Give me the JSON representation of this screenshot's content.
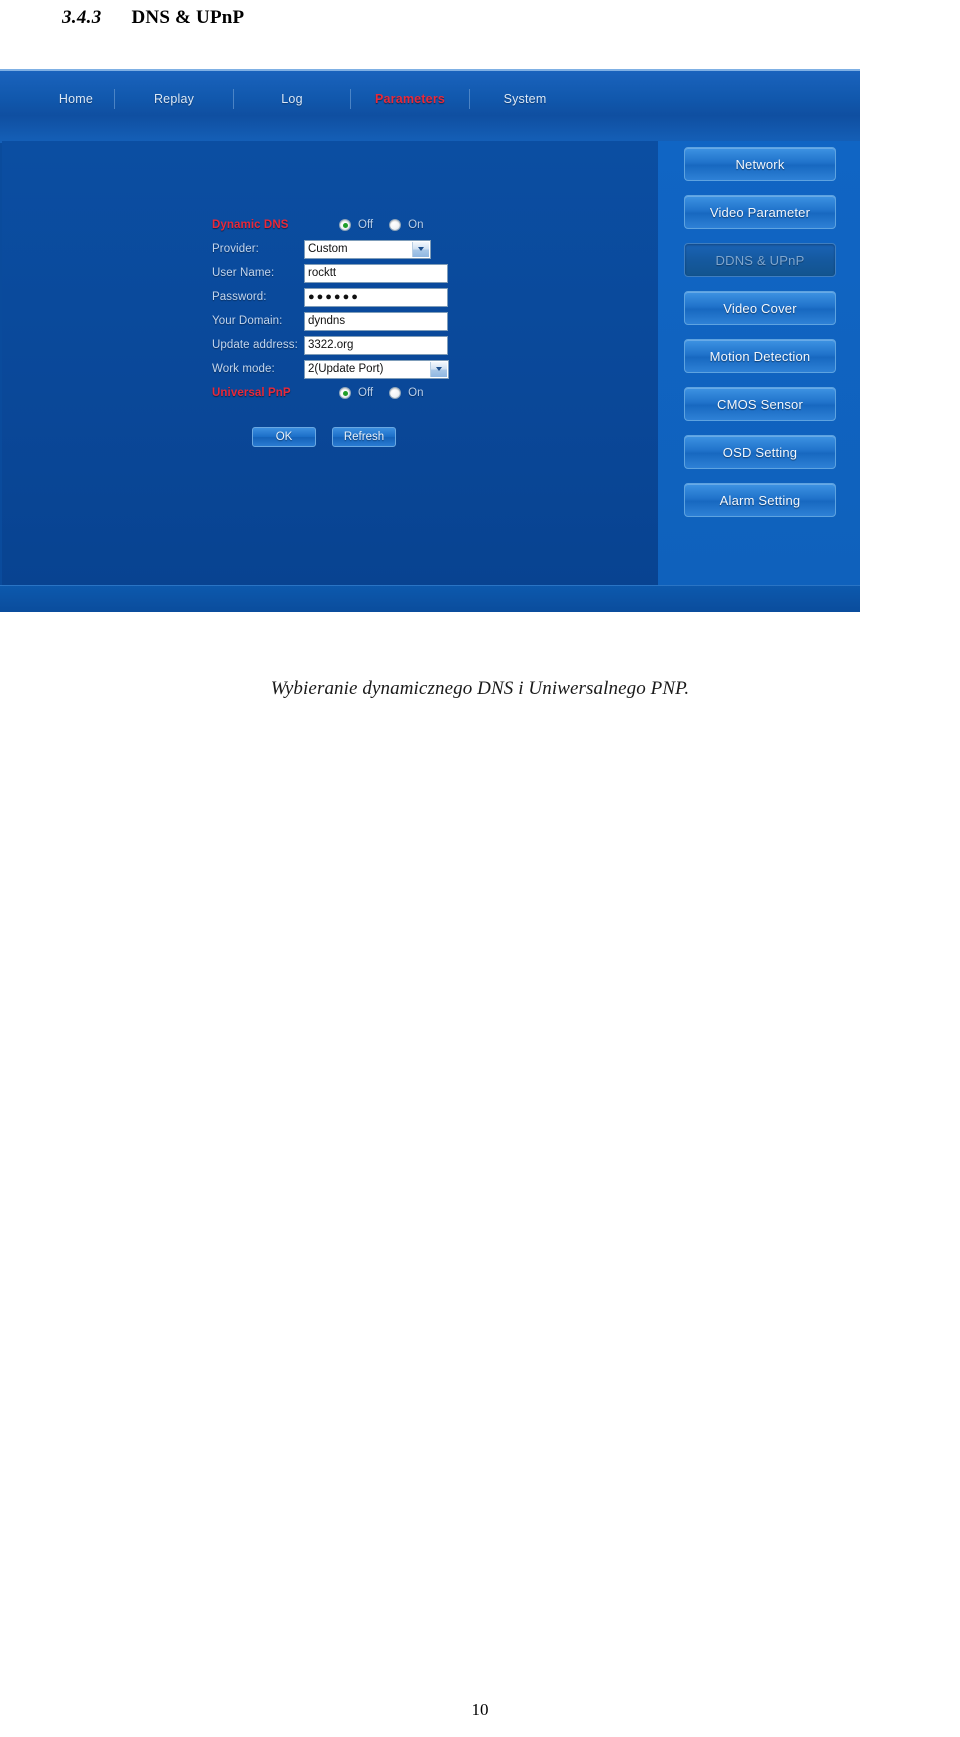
{
  "document": {
    "heading_number": "3.4.3",
    "heading_title": "DNS & UPnP",
    "caption": "Wybieranie dynamicznego DNS i Uniwersalnego PNP.",
    "page_number": "10"
  },
  "device_ui": {
    "nav": {
      "items": [
        {
          "label": "Home",
          "active": false
        },
        {
          "label": "Replay",
          "active": false
        },
        {
          "label": "Log",
          "active": false
        },
        {
          "label": "Parameters",
          "active": true
        },
        {
          "label": "System",
          "active": false
        }
      ],
      "active_color": "#e8293a",
      "inactive_color": "#dbe8f7"
    },
    "form": {
      "dynamic_dns": {
        "label": "Dynamic DNS",
        "options": [
          {
            "label": "Off",
            "selected": true
          },
          {
            "label": "On",
            "selected": false
          }
        ]
      },
      "provider": {
        "label": "Provider:",
        "value": "Custom",
        "icon": "chevron-down-icon"
      },
      "user_name": {
        "label": "User Name:",
        "value": "rocktt"
      },
      "password": {
        "label": "Password:",
        "value": "●●●●●●"
      },
      "your_domain": {
        "label": "Your Domain:",
        "value": "dyndns"
      },
      "update_address": {
        "label": "Update address:",
        "value": "3322.org"
      },
      "work_mode": {
        "label": "Work mode:",
        "value": "2(Update Port)",
        "icon": "chevron-down-icon"
      },
      "universal_pnp": {
        "label": "Universal PnP",
        "options": [
          {
            "label": "Off",
            "selected": true
          },
          {
            "label": "On",
            "selected": false
          }
        ]
      },
      "buttons": {
        "ok": "OK",
        "refresh": "Refresh"
      }
    },
    "sidebar": {
      "items": [
        {
          "label": "Network",
          "active": false
        },
        {
          "label": "Video Parameter",
          "active": false
        },
        {
          "label": "DDNS & UPnP",
          "active": true
        },
        {
          "label": "Video Cover",
          "active": false
        },
        {
          "label": "Motion Detection",
          "active": false
        },
        {
          "label": "CMOS Sensor",
          "active": false
        },
        {
          "label": "OSD Setting",
          "active": false
        },
        {
          "label": "Alarm Setting",
          "active": false
        }
      ]
    }
  }
}
